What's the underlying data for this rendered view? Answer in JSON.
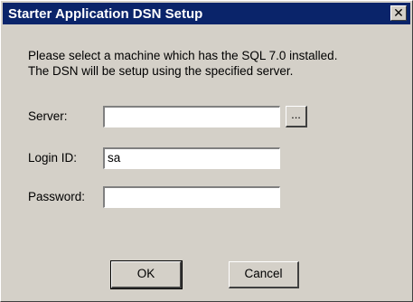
{
  "window": {
    "title": "Starter Application DSN Setup",
    "close_symbol": "✕"
  },
  "instructions": {
    "line1": "Please select a machine which has the SQL 7.0 installed.",
    "line2": "The DSN will be setup using the specified server."
  },
  "form": {
    "server_label": "Server:",
    "server_value": "",
    "browse_label": "...",
    "login_label": "Login ID:",
    "login_value": "sa",
    "password_label": "Password:",
    "password_value": ""
  },
  "buttons": {
    "ok_label": "OK",
    "cancel_label": "Cancel"
  },
  "colors": {
    "title_bar": "#0a246a",
    "dialog_face": "#d4d0c8"
  },
  "icons": {
    "close": "close-icon"
  }
}
